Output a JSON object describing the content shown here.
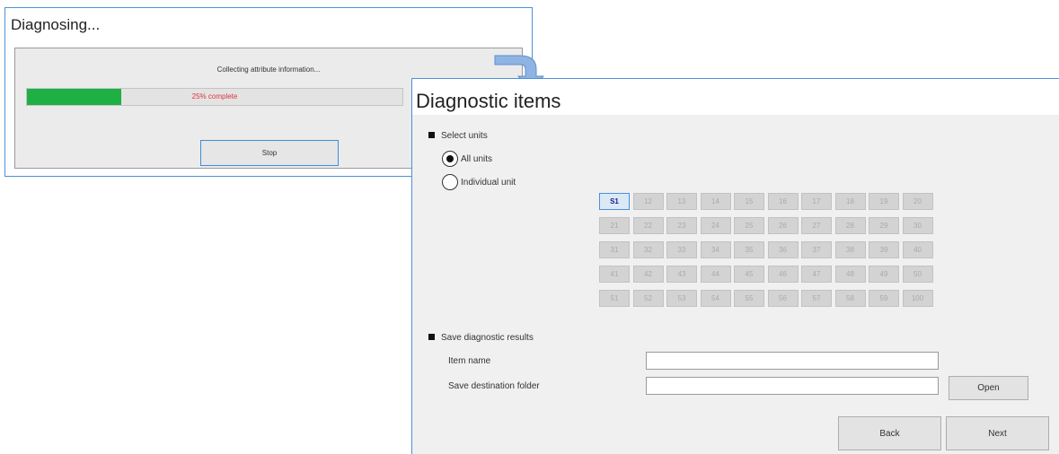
{
  "diagnosing_dialog": {
    "title": "Diagnosing...",
    "status_message": "Collecting attribute information...",
    "progress": {
      "fraction": 0.25,
      "text": "25% complete"
    },
    "stop_label": "Stop"
  },
  "diagnostic_window": {
    "title": "Diagnostic items",
    "select_units": {
      "heading": "Select units",
      "options": [
        {
          "label": "All units",
          "selected": true
        },
        {
          "label": "Individual unit",
          "selected": false
        }
      ],
      "units": [
        "S1",
        "12",
        "13",
        "14",
        "15",
        "16",
        "17",
        "18",
        "19",
        "20",
        "21",
        "22",
        "23",
        "24",
        "25",
        "26",
        "27",
        "28",
        "29",
        "30",
        "31",
        "32",
        "33",
        "34",
        "35",
        "36",
        "37",
        "38",
        "39",
        "40",
        "41",
        "42",
        "43",
        "44",
        "45",
        "46",
        "47",
        "48",
        "49",
        "50",
        "51",
        "52",
        "53",
        "54",
        "55",
        "56",
        "57",
        "58",
        "59",
        "100"
      ],
      "active_unit": "S1"
    },
    "save_results": {
      "heading": "Save diagnostic results",
      "item_name_label": "Item name",
      "item_name_value": "",
      "folder_label": "Save destination folder",
      "folder_value": "",
      "open_label": "Open"
    },
    "back_label": "Back",
    "next_label": "Next"
  },
  "colors": {
    "progress_fill": "#1eb043",
    "progress_text": "#e0343a",
    "accent": "#4a90d9"
  },
  "icons": {
    "flow_arrow": "curved-arrow-icon"
  }
}
